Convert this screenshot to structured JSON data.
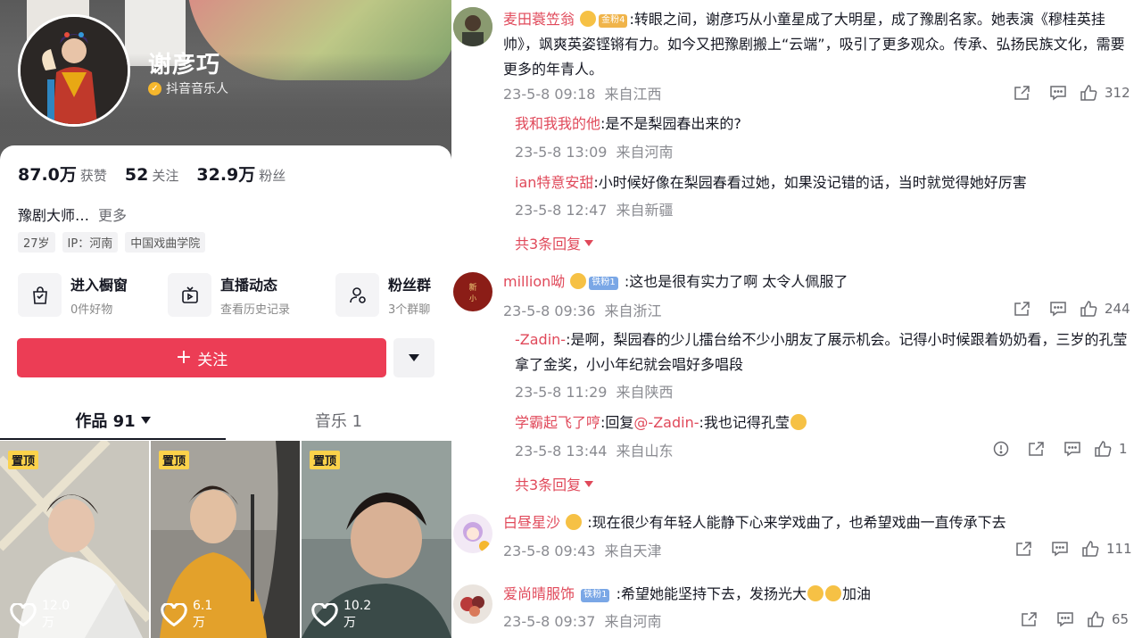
{
  "profile": {
    "name": "谢彦巧",
    "verified_label": "抖音音乐人",
    "stats": [
      {
        "num": "87.0万",
        "label": "获赞"
      },
      {
        "num": "52",
        "label": "关注"
      },
      {
        "num": "32.9万",
        "label": "粉丝"
      }
    ],
    "bio": "豫剧大师…",
    "bio_more": "更多",
    "tags": [
      "27岁",
      "IP：河南",
      "中国戏曲学院"
    ],
    "features": [
      {
        "title": "进入橱窗",
        "sub": "0件好物",
        "icon": "shopping-bag-icon"
      },
      {
        "title": "直播动态",
        "sub": "查看历史记录",
        "icon": "live-tv-icon"
      },
      {
        "title": "粉丝群",
        "sub": "3个群聊",
        "icon": "fan-group-icon"
      }
    ],
    "follow_label": "关注",
    "follow_plus": "+",
    "tabs": {
      "works": "作品 91",
      "music": "音乐 1"
    },
    "videos": [
      {
        "pin": "置顶",
        "likes": "12.0万"
      },
      {
        "pin": "置顶",
        "likes": "6.1万"
      },
      {
        "pin": "置顶",
        "likes": "10.2万"
      }
    ]
  },
  "comments": [
    {
      "user": "麦田蓑笠翁",
      "badge": "金粉4",
      "text_prefix": ":",
      "text": "转眼之间，谢彦巧从小童星成了大明星，成了豫剧名家。她表演《穆桂英挂帅》，飒爽英姿铿锵有力。如今又把豫剧搬上“云端”，吸引了更多观众。传承、弘扬民族文化，需要更多的年青人。",
      "date": "23-5-8 09:18",
      "location": "来自江西",
      "likes": "312",
      "replies": [
        {
          "user": "我和我我的他",
          "text": ":是不是梨园春出来的?",
          "date": "23-5-8 13:09",
          "location": "来自河南"
        },
        {
          "user": "ian特意安甜",
          "text": ":小时候好像在梨园春看过她，如果没记错的话，当时就觉得她好厉害",
          "date": "23-5-8 12:47",
          "location": "来自新疆"
        }
      ],
      "expand": "共3条回复"
    },
    {
      "user": "million呦",
      "badge": "铁粉1",
      "text": ":这也是很有实力了啊 太令人佩服了",
      "date": "23-5-8 09:36",
      "location": "来自浙江",
      "likes": "244",
      "replies": [
        {
          "user": "-Zadin-",
          "text": ":是啊，梨园春的少儿擂台给不少小朋友了展示机会。记得小时候跟着奶奶看，三岁的孔莹拿了金奖，小小年纪就会唱好多唱段",
          "date": "23-5-8 11:29",
          "location": "来自陕西"
        },
        {
          "user": "学霸起飞了哼",
          "text_pre": ":回复",
          "mention": "@-Zadin-",
          "text_post": ":我也记得孔莹",
          "date": "23-5-8 13:44",
          "location": "来自山东",
          "likes": "1"
        }
      ],
      "expand": "共3条回复"
    },
    {
      "user": "白昼星沙",
      "text": ":现在很少有年轻人能静下心来学戏曲了，也希望戏曲一直传承下去",
      "date": "23-5-8 09:43",
      "location": "来自天津",
      "likes": "111"
    },
    {
      "user": "爱尚晴服饰",
      "badge": "铁粉1",
      "text_pre": ":希望她能坚持下去，发扬光大",
      "text_post": "加油",
      "date": "23-5-8 09:37",
      "location": "来自河南",
      "likes": "65"
    }
  ],
  "colors": {
    "accent": "#e0495a",
    "follow": "#ec3d55",
    "pin": "#fbd24b"
  }
}
